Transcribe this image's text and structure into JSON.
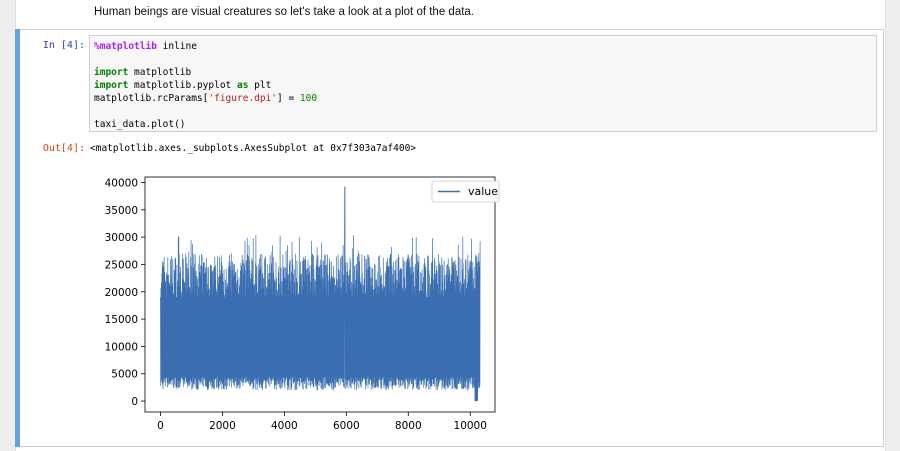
{
  "markdown": {
    "text": "Human beings are visual creatures so let's take a look at a plot of the data."
  },
  "cell": {
    "in_prompt": "In [4]:",
    "out_prompt": "Out[4]:",
    "code_lines": [
      {
        "tokens": [
          {
            "t": "%matplotlib",
            "c": "mag"
          },
          {
            "t": " inline",
            "c": ""
          }
        ]
      },
      {
        "tokens": []
      },
      {
        "tokens": [
          {
            "t": "import",
            "c": "kw"
          },
          {
            "t": " matplotlib",
            "c": ""
          }
        ]
      },
      {
        "tokens": [
          {
            "t": "import",
            "c": "kw"
          },
          {
            "t": " matplotlib.pyplot ",
            "c": ""
          },
          {
            "t": "as",
            "c": "kw"
          },
          {
            "t": " plt",
            "c": ""
          }
        ]
      },
      {
        "tokens": [
          {
            "t": "matplotlib.rcParams[",
            "c": ""
          },
          {
            "t": "'figure.dpi'",
            "c": "str"
          },
          {
            "t": "] = ",
            "c": ""
          },
          {
            "t": "100",
            "c": "num"
          }
        ]
      },
      {
        "tokens": []
      },
      {
        "tokens": [
          {
            "t": "taxi_data.plot()",
            "c": ""
          }
        ]
      }
    ],
    "output_text": "<matplotlib.axes._subplots.AxesSubplot at 0x7f303a7af400>"
  },
  "chart_data": {
    "type": "line",
    "series": [
      {
        "name": "value",
        "color": "#3a6eb0"
      }
    ],
    "x_range": [
      0,
      10320
    ],
    "xlim": [
      -500,
      10800
    ],
    "ylim": [
      -2000,
      41000
    ],
    "xticks": [
      0,
      2000,
      4000,
      6000,
      8000,
      10000
    ],
    "yticks": [
      0,
      5000,
      10000,
      15000,
      20000,
      25000,
      30000,
      35000,
      40000
    ],
    "xticklabels": [
      "0",
      "2000",
      "4000",
      "6000",
      "8000",
      "10000"
    ],
    "yticklabels": [
      "0",
      "5000",
      "10000",
      "15000",
      "20000",
      "25000",
      "30000",
      "35000",
      "40000"
    ],
    "typical_low": 2000,
    "typical_high": 24000,
    "peak": {
      "x": 5950,
      "y": 39200
    },
    "legend_position": "upper right",
    "grid": false
  }
}
